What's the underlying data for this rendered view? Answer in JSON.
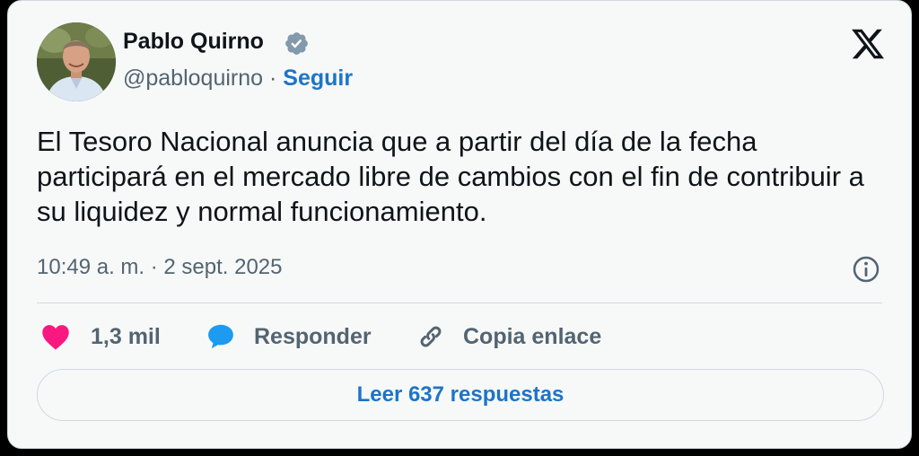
{
  "colors": {
    "link_blue": "#1d74c8",
    "heart_pink": "#f91880",
    "reply_blue": "#1d9bf0",
    "text_primary": "#0f1419",
    "text_secondary": "#536471",
    "card_background": "#f7f9f9"
  },
  "author": {
    "name": "Pablo Quirno",
    "verified_icon": "verified-badge-icon",
    "handle": "@pabloquirno",
    "separator": " · ",
    "follow_label": "Seguir"
  },
  "platform_icon": "x-logo-icon",
  "tweet": {
    "text": "El Tesoro Nacional anuncia que a partir del día de la fecha participará en el mercado libre de cambios con el fin de contribuir a su liquidez y normal funcionamiento.",
    "timestamp": "10:49 a. m. · 2 sept. 2025",
    "info_icon": "info-icon"
  },
  "actions": {
    "like": {
      "icon": "heart-icon",
      "label": "1,3 mil"
    },
    "reply": {
      "icon": "speech-bubble-icon",
      "label": "Responder"
    },
    "copy": {
      "icon": "link-icon",
      "label": "Copia enlace"
    }
  },
  "read_replies_label": "Leer 637 respuestas"
}
